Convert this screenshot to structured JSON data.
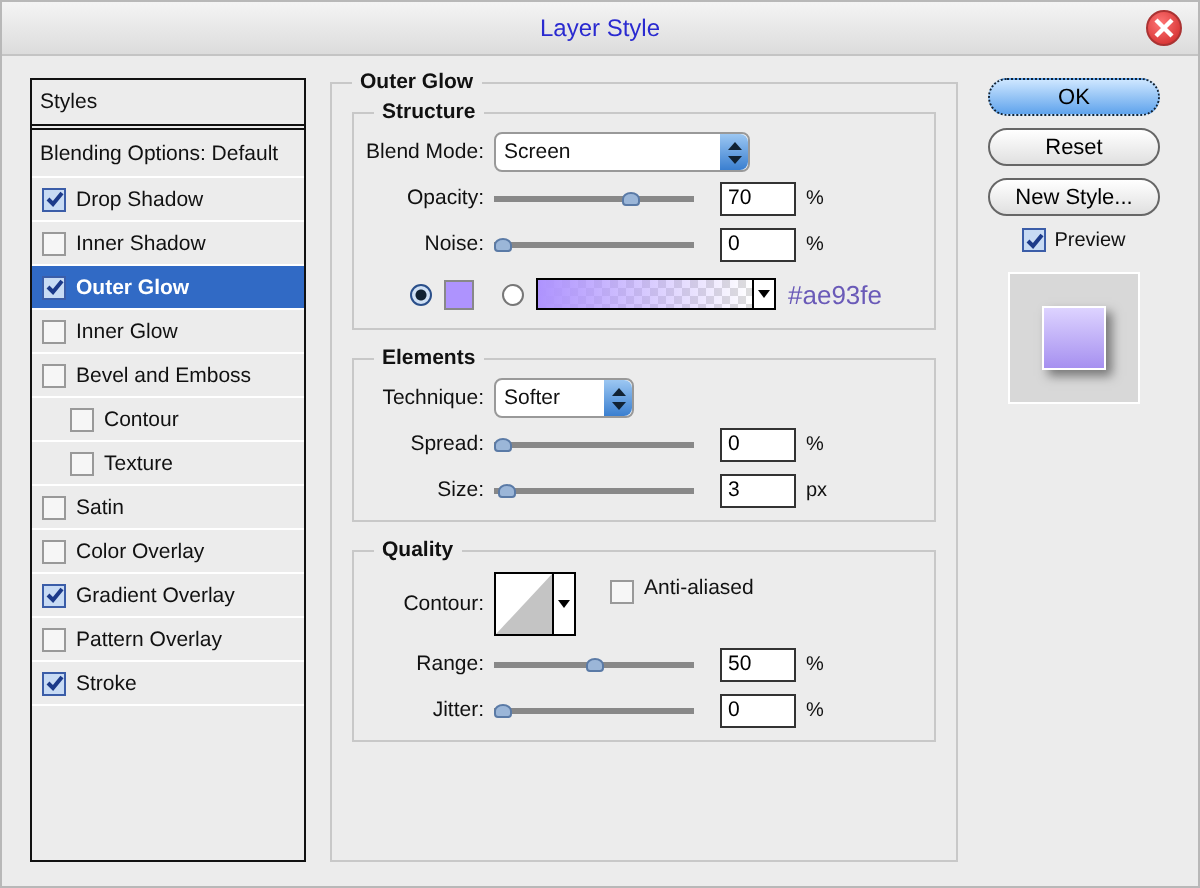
{
  "window": {
    "title": "Layer Style"
  },
  "sidebar": {
    "header": "Styles",
    "blending": "Blending Options: Default",
    "items": [
      {
        "label": "Drop Shadow",
        "checked": true,
        "selected": false
      },
      {
        "label": "Inner Shadow",
        "checked": false,
        "selected": false
      },
      {
        "label": "Outer Glow",
        "checked": true,
        "selected": true
      },
      {
        "label": "Inner Glow",
        "checked": false,
        "selected": false
      },
      {
        "label": "Bevel and Emboss",
        "checked": false,
        "selected": false,
        "children": [
          {
            "label": "Contour",
            "checked": false,
            "selected": false
          },
          {
            "label": "Texture",
            "checked": false,
            "selected": false
          }
        ]
      },
      {
        "label": "Satin",
        "checked": false,
        "selected": false
      },
      {
        "label": "Color Overlay",
        "checked": false,
        "selected": false
      },
      {
        "label": "Gradient Overlay",
        "checked": true,
        "selected": false
      },
      {
        "label": "Pattern Overlay",
        "checked": false,
        "selected": false
      },
      {
        "label": "Stroke",
        "checked": true,
        "selected": false
      }
    ]
  },
  "panel": {
    "title": "Outer Glow",
    "structure": {
      "title": "Structure",
      "blend_label": "Blend Mode:",
      "blend_value": "Screen",
      "sliders": [
        {
          "label": "Opacity:",
          "level": 0.7,
          "value": "70",
          "unit": "%"
        },
        {
          "label": "Noise:",
          "level": 0,
          "value": "0",
          "unit": "%"
        }
      ],
      "color_options": [
        {
          "kind": "solid",
          "selected": true,
          "color": "#ae93fe"
        },
        {
          "kind": "gradient",
          "selected": false,
          "color": "#ae93fe"
        }
      ],
      "hex": "#ae93fe"
    },
    "elements": {
      "title": "Elements",
      "technique_label": "Technique:",
      "technique_value": "Softer",
      "sliders": [
        {
          "label": "Spread:",
          "level": 0,
          "value": "0",
          "unit": "%"
        },
        {
          "label": "Size:",
          "level": 0.02,
          "value": "3",
          "unit": "px"
        }
      ]
    },
    "quality": {
      "title": "Quality",
      "contour_label": "Contour:",
      "anti_aliased": {
        "label": "Anti-aliased",
        "checked": false
      },
      "sliders": [
        {
          "label": "Range:",
          "level": 0.5,
          "value": "50",
          "unit": "%"
        },
        {
          "label": "Jitter:",
          "level": 0,
          "value": "0",
          "unit": "%"
        }
      ]
    }
  },
  "buttons": [
    {
      "label": "OK",
      "default": true
    },
    {
      "label": "Reset",
      "default": false
    },
    {
      "label": "New Style...",
      "default": false
    }
  ],
  "preview": {
    "label": "Preview",
    "checked": true
  }
}
